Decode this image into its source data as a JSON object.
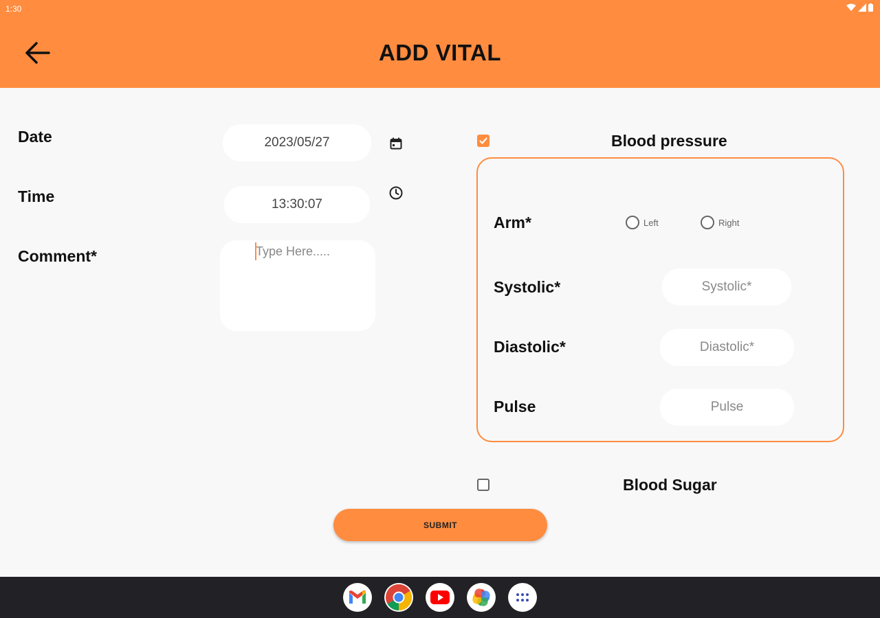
{
  "status_bar": {
    "time": "1:30"
  },
  "header": {
    "title": "ADD VITAL"
  },
  "form": {
    "date_label": "Date",
    "date_value": "2023/05/27",
    "time_label": "Time",
    "time_value": "13:30:07",
    "comment_label": "Comment*",
    "comment_placeholder": "Type Here....."
  },
  "blood_pressure": {
    "title": "Blood pressure",
    "checked": true,
    "arm_label": "Arm*",
    "arm_options": [
      "Left",
      "Right"
    ],
    "systolic_label": "Systolic*",
    "systolic_placeholder": "Systolic*",
    "diastolic_label": "Diastolic*",
    "diastolic_placeholder": "Diastolic*",
    "pulse_label": "Pulse",
    "pulse_placeholder": "Pulse"
  },
  "blood_sugar": {
    "title": "Blood Sugar",
    "checked": false
  },
  "submit_label": "SUBMIT",
  "dock": {
    "apps": [
      "gmail-icon",
      "chrome-icon",
      "youtube-icon",
      "photos-icon",
      "app-drawer-icon"
    ]
  },
  "colors": {
    "accent": "#ff8c3f",
    "background": "#f8f8f8",
    "navbar": "#222226"
  }
}
